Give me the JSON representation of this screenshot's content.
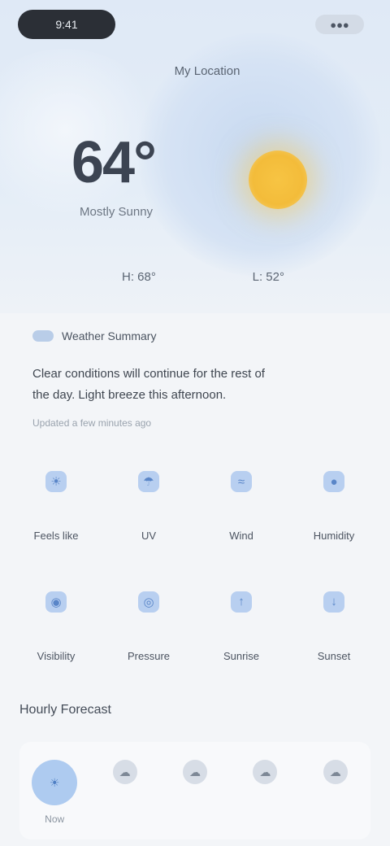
{
  "status_bar": {
    "time": "9:41",
    "right": "●●●"
  },
  "hero": {
    "location": "My Location",
    "temperature": "64°",
    "condition": "Mostly Sunny",
    "high": "H: 68°",
    "low": "L: 52°"
  },
  "summary": {
    "label": "Weather Summary",
    "text": "Clear conditions will continue for the rest of the day. Light breeze this afternoon.",
    "sub": "Updated a few minutes ago"
  },
  "details": [
    {
      "icon": "thermometer-icon",
      "glyph": "☀",
      "value": "",
      "label": "Feels like"
    },
    {
      "icon": "drop-icon",
      "glyph": "☂",
      "value": "",
      "label": "UV"
    },
    {
      "icon": "wind-icon",
      "glyph": "≈",
      "value": "",
      "label": "Wind"
    },
    {
      "icon": "humidity-icon",
      "glyph": "●",
      "value": "",
      "label": "Humidity"
    },
    {
      "icon": "visibility-icon",
      "glyph": "◉",
      "value": "",
      "label": "Visibility"
    },
    {
      "icon": "pressure-icon",
      "glyph": "◎",
      "value": "",
      "label": "Pressure"
    },
    {
      "icon": "sunrise-icon",
      "glyph": "↑",
      "value": "",
      "label": "Sunrise"
    },
    {
      "icon": "sunset-icon",
      "glyph": "↓",
      "value": "",
      "label": "Sunset"
    }
  ],
  "hourly": {
    "title": "Hourly Forecast",
    "items": [
      {
        "icon": "sun-icon",
        "glyph": "☀",
        "time": "Now",
        "active": true
      },
      {
        "icon": "cloud-icon",
        "glyph": "☁",
        "time": ""
      },
      {
        "icon": "cloud-icon",
        "glyph": "☁",
        "time": ""
      },
      {
        "icon": "cloud-icon",
        "glyph": "☁",
        "time": ""
      },
      {
        "icon": "cloud-icon",
        "glyph": "☁",
        "time": ""
      }
    ]
  },
  "colors": {
    "accent": "#aecbf0",
    "sun": "#f3bc3a",
    "background": "#f3f5f8"
  }
}
